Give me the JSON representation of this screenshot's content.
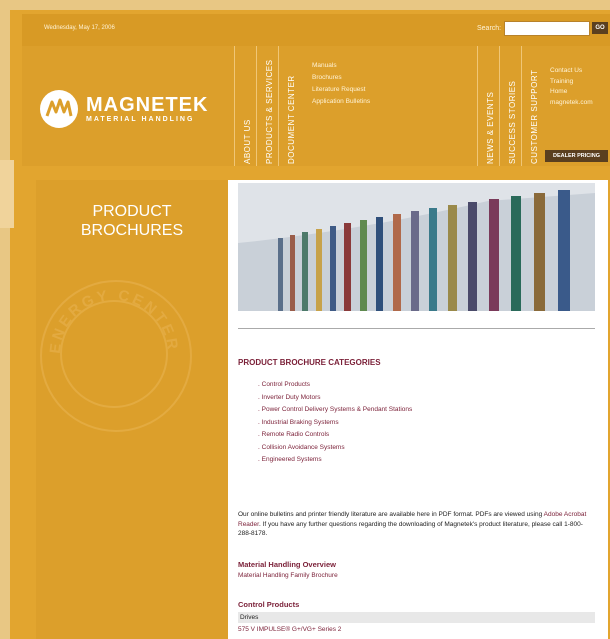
{
  "header": {
    "date": "Wednesday, May 17, 2006",
    "search_label": "Search:",
    "search_value": "",
    "go_label": "GO",
    "logo_name": "MAGNETEK",
    "logo_subtitle": "MATERIAL HANDLING",
    "nav_tabs": [
      {
        "label": "ABOUT US"
      },
      {
        "label": "PRODUCTS & SERVICES"
      },
      {
        "label": "DOCUMENT CENTER"
      },
      {
        "label": "NEWS & EVENTS"
      },
      {
        "label": "SUCCESS STORIES"
      },
      {
        "label": "CUSTOMER SUPPORT"
      }
    ],
    "document_menu": [
      "Manuals",
      "Brochures",
      "Literature Request",
      "Application Bulletins"
    ],
    "right_menu": [
      "Contact Us",
      "Training",
      "Home",
      "magnetek.com"
    ],
    "dealer_button": "DEALER PRICING"
  },
  "sidebar": {
    "title_line1": "PRODUCT",
    "title_line2": "BROCHURES",
    "seal_text": "ENERGY CENTERED"
  },
  "main": {
    "categories_heading": "PRODUCT BROCHURE CATEGORIES",
    "categories": [
      "Control Products",
      "Inverter Duty Motors",
      "Power Control Delivery Systems & Pendant Stations",
      "Industrial Braking Systems",
      "Remote Radio Controls",
      "Collision Avoidance Systems",
      "Engineered Systems"
    ],
    "pdf_text_part1": "Our online bulletins and printer friendly literature are available here in PDF format. PDFs are viewed using ",
    "pdf_link": "Adobe Acrobat Reader",
    "pdf_text_part2": ". If you have any further questions regarding the downloading of Magnetek's product literature, please call 1-800-288-8178.",
    "overview_heading": "Material Handling Overview",
    "overview_link": "Material Handling Family Brochure",
    "control_heading": "Control Products",
    "drives_label": "Drives",
    "impulse_link": "575 V IMPULSE® G+/VG+ Series 2"
  },
  "colors": {
    "brand_gold": "#dc9f2b",
    "accent_maroon": "#7a1f37",
    "dark_button": "#5a3f1f"
  }
}
